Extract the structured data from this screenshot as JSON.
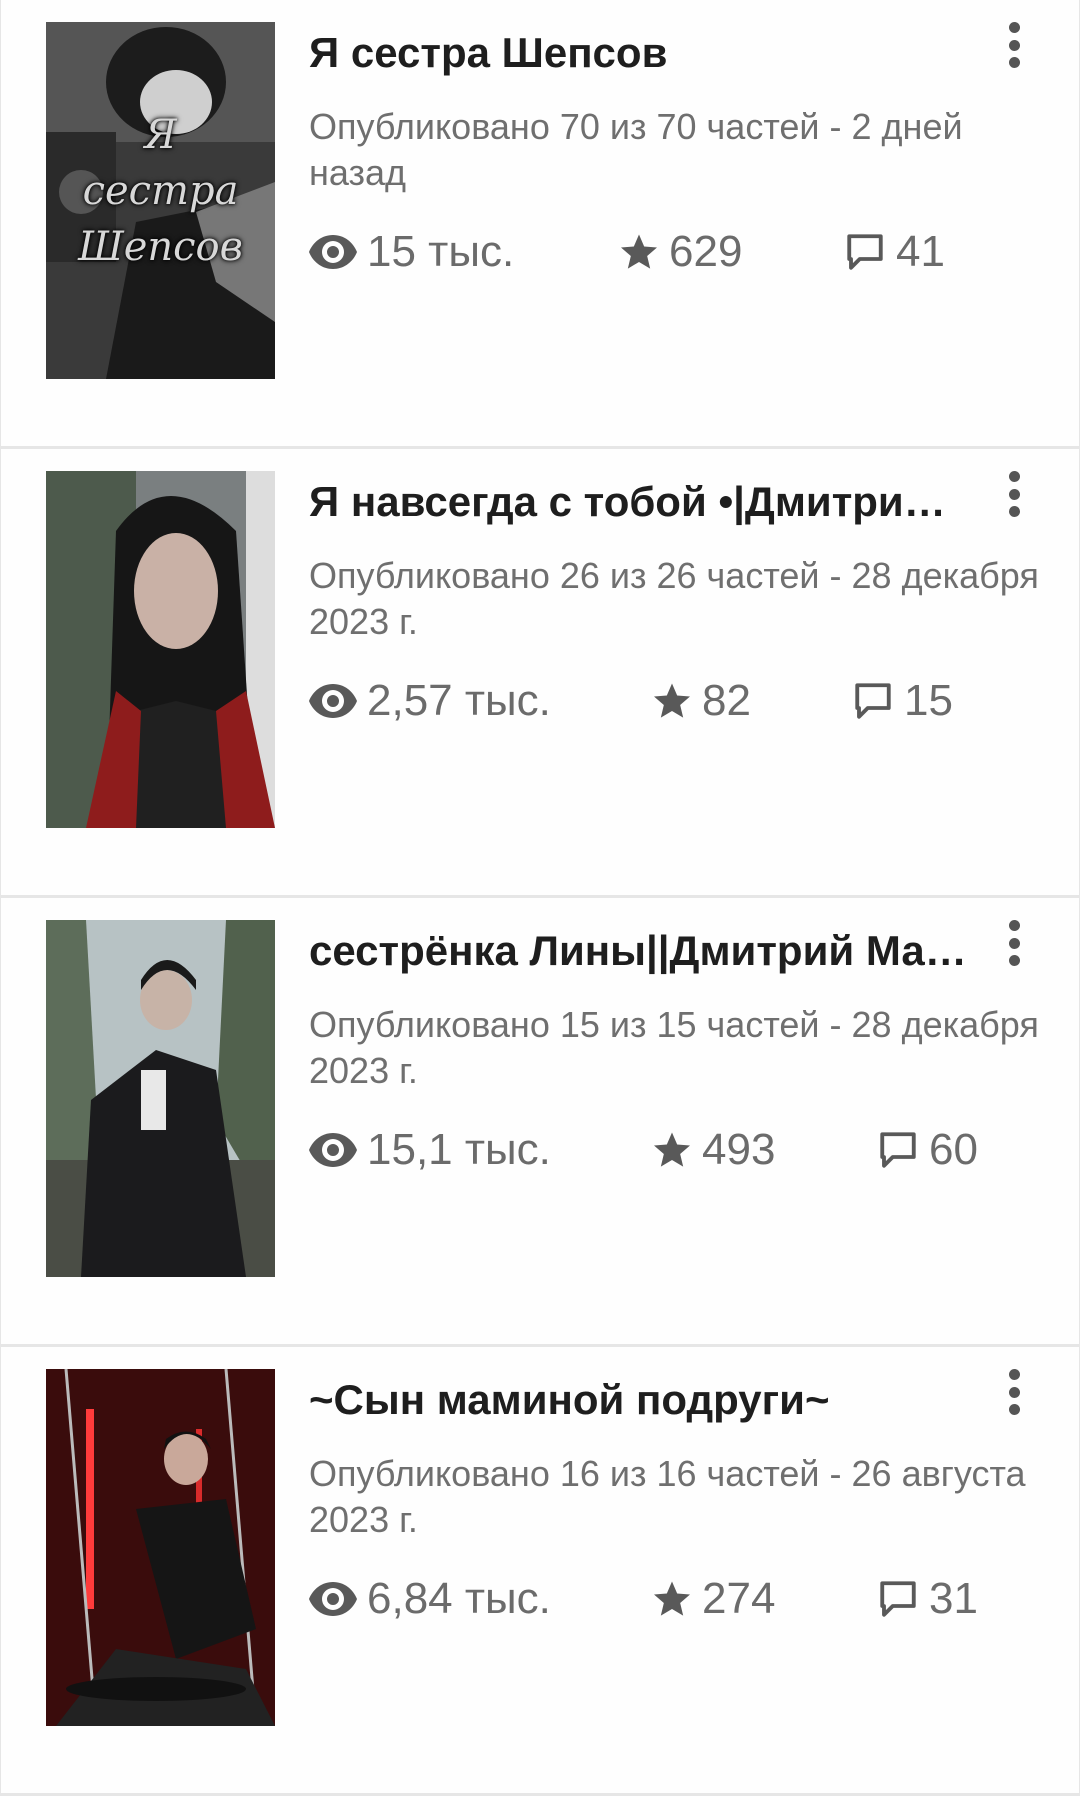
{
  "stories": [
    {
      "title": "Я сестра Шепсов",
      "meta": "Опубликовано 70 из 70 частей - 2 дней назад",
      "views": "15 тыс.",
      "votes": "629",
      "comments": "41",
      "cover_text": [
        "Я",
        "сестра",
        "Шепсов"
      ],
      "stats_gaps": [
        0,
        0
      ]
    },
    {
      "title": "Я навсегда с тобой •|Дмитрий…",
      "meta": "Опубликовано 26 из 26 частей - 28 декабря 2023 г.",
      "views": "2,57 тыс.",
      "votes": "82",
      "comments": "15"
    },
    {
      "title": "сестрёнка Лины||Дмитрий Ма…",
      "meta": "Опубликовано 15 из 15 частей - 28 декабря 2023 г.",
      "views": "15,1 тыс.",
      "votes": "493",
      "comments": "60"
    },
    {
      "title": "~Сын маминой подруги~",
      "meta": "Опубликовано 16 из 16 частей - 26 августа 2023 г.",
      "views": "6,84 тыс.",
      "votes": "274",
      "comments": "31"
    }
  ],
  "icons": {
    "views": "eye-icon",
    "votes": "star-icon",
    "comments": "comment-icon",
    "more": "more-vertical-icon"
  },
  "colors": {
    "meta_text": "#6f6f6f",
    "stat_text": "#6b6b6b",
    "divider": "#e6e6e6"
  }
}
